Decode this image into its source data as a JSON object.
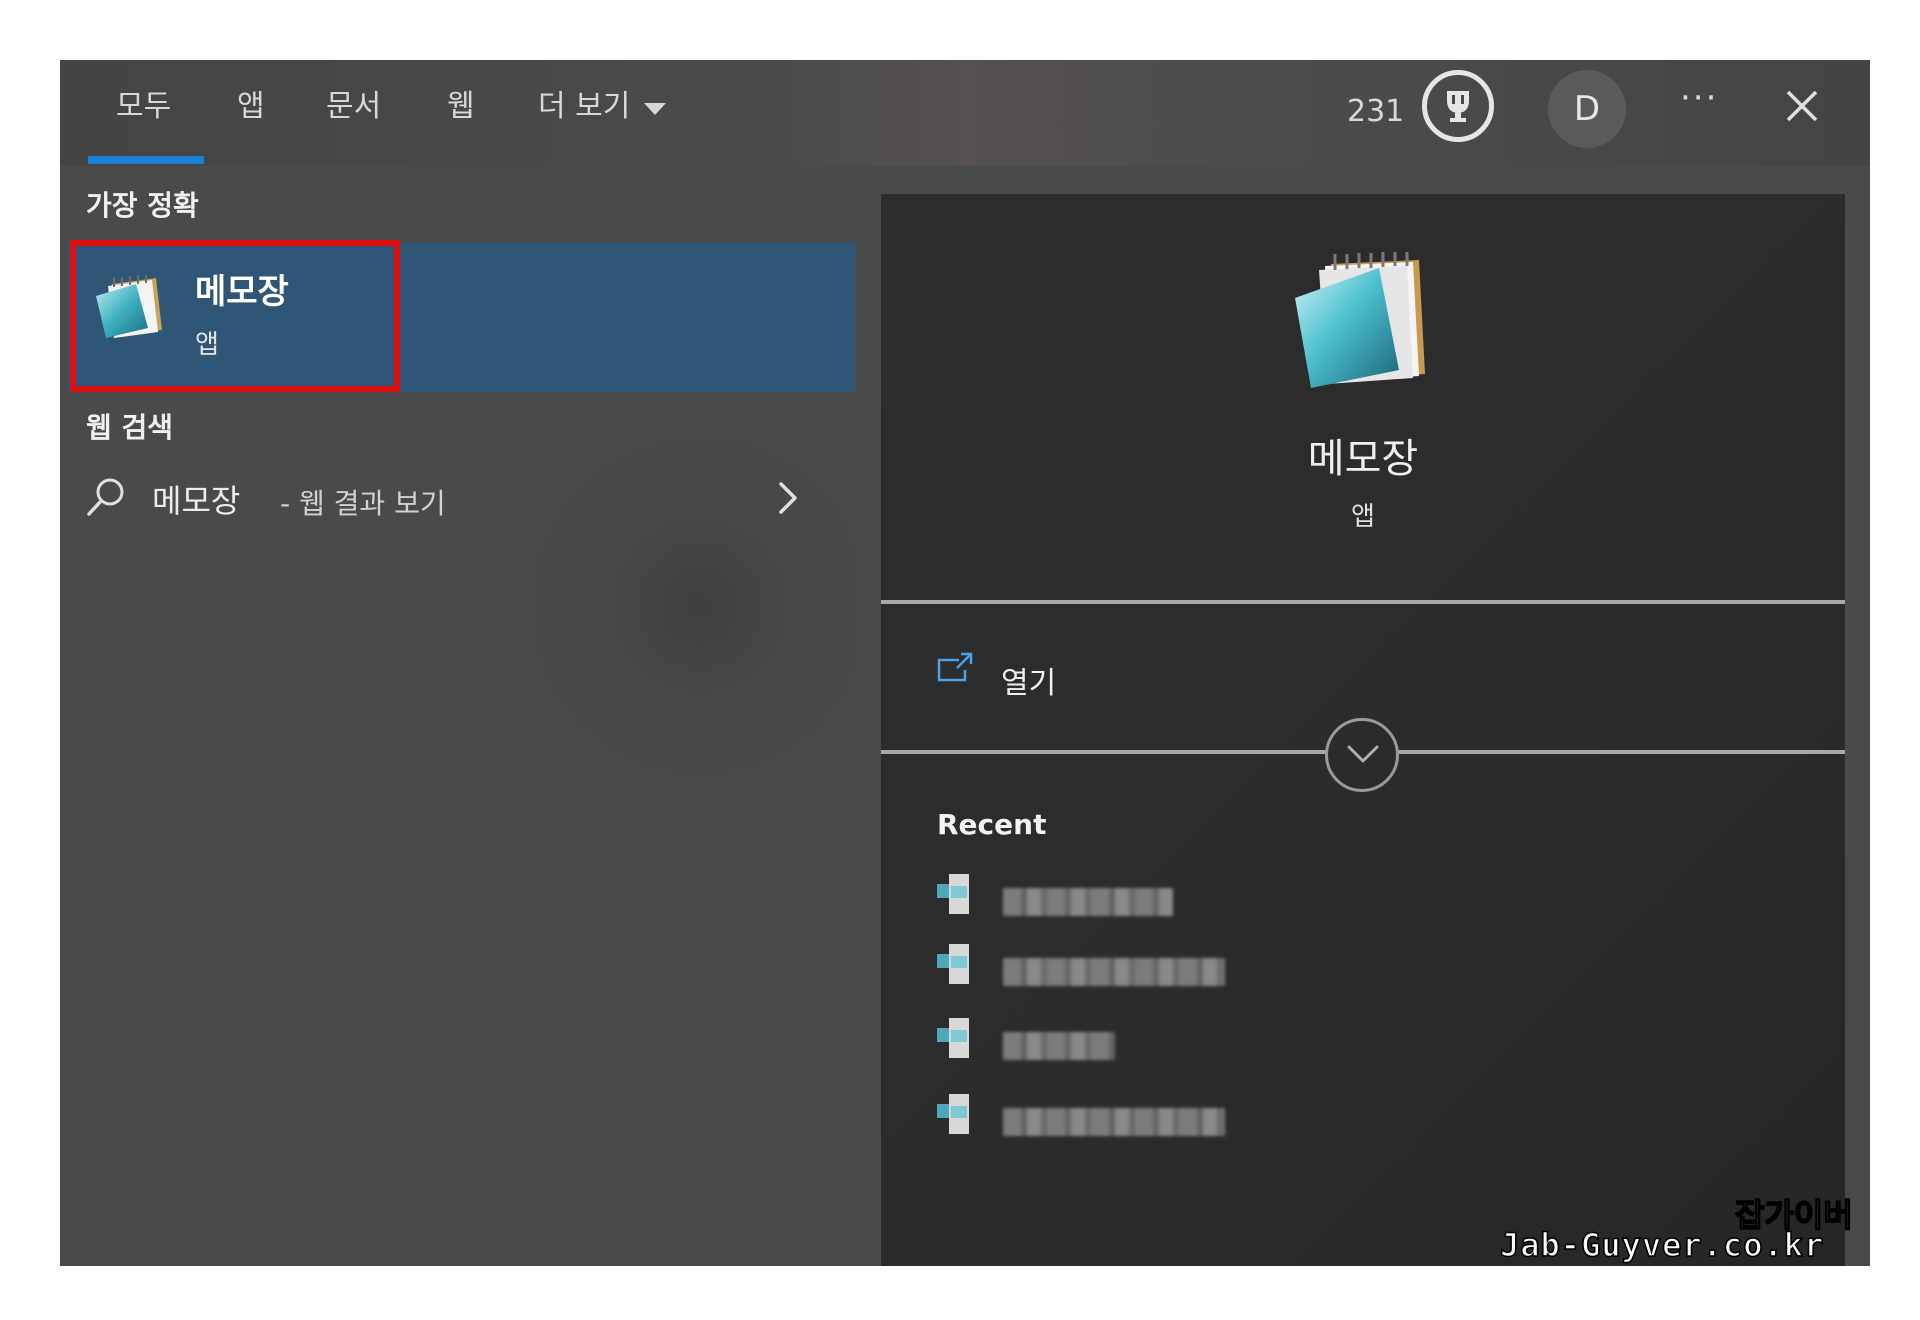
{
  "tabs": {
    "all": "모두",
    "apps": "앱",
    "documents": "문서",
    "web": "웹",
    "more": "더 보기"
  },
  "header": {
    "points": "231",
    "avatar_initial": "D",
    "more_options": "···"
  },
  "best_match": {
    "section_title": "가장 정확",
    "name": "메모장",
    "type": "앱"
  },
  "web_search": {
    "section_title": "웹 검색",
    "query": "메모장",
    "suffix": "- 웹 결과 보기"
  },
  "detail": {
    "name": "메모장",
    "type": "앱",
    "open_label": "열기",
    "recent_title": "Recent",
    "recent_count_blurred": 4
  },
  "watermark": {
    "line1": "잡가이버",
    "line2": "Jab-Guyver.co.kr"
  },
  "colors": {
    "accent": "#1a7fd6",
    "selected_bg": "#2f5677",
    "highlight_border": "#e00f0f",
    "pane_bg": "#4a4a4a",
    "detail_bg": "#2b2b2b"
  }
}
